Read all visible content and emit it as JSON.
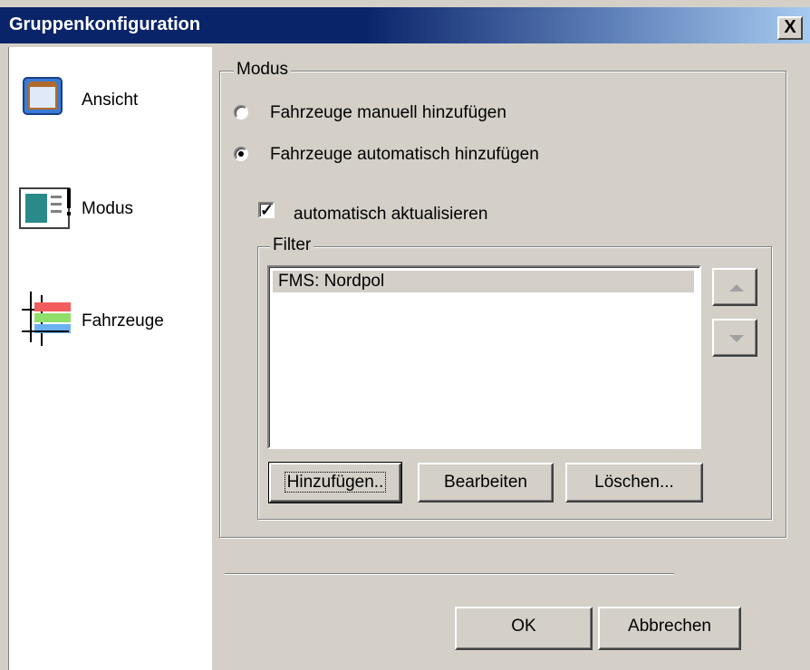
{
  "window": {
    "title": "Gruppenkonfiguration",
    "close_label": "X"
  },
  "nav": {
    "items": [
      {
        "label": "Ansicht",
        "icon": "window-icon"
      },
      {
        "label": "Modus",
        "icon": "mode-icon"
      },
      {
        "label": "Fahrzeuge",
        "icon": "vehicles-icon"
      }
    ]
  },
  "modus": {
    "legend": "Modus",
    "radio_manual": {
      "label": "Fahrzeuge manuell hinzufügen",
      "checked": false
    },
    "radio_auto": {
      "label": "Fahrzeuge automatisch hinzufügen",
      "checked": true
    },
    "auto_update": {
      "label": "automatisch aktualisieren",
      "checked": true
    }
  },
  "filter": {
    "legend": "Filter",
    "items": [
      "FMS: Nordpol"
    ],
    "add_label": "Hinzufügen..",
    "edit_label": "Bearbeiten",
    "delete_label": "Löschen..."
  },
  "footer": {
    "ok_label": "OK",
    "cancel_label": "Abbrechen"
  },
  "colors": {
    "titlebar": "#0a246a",
    "face": "#d4d0c8"
  }
}
